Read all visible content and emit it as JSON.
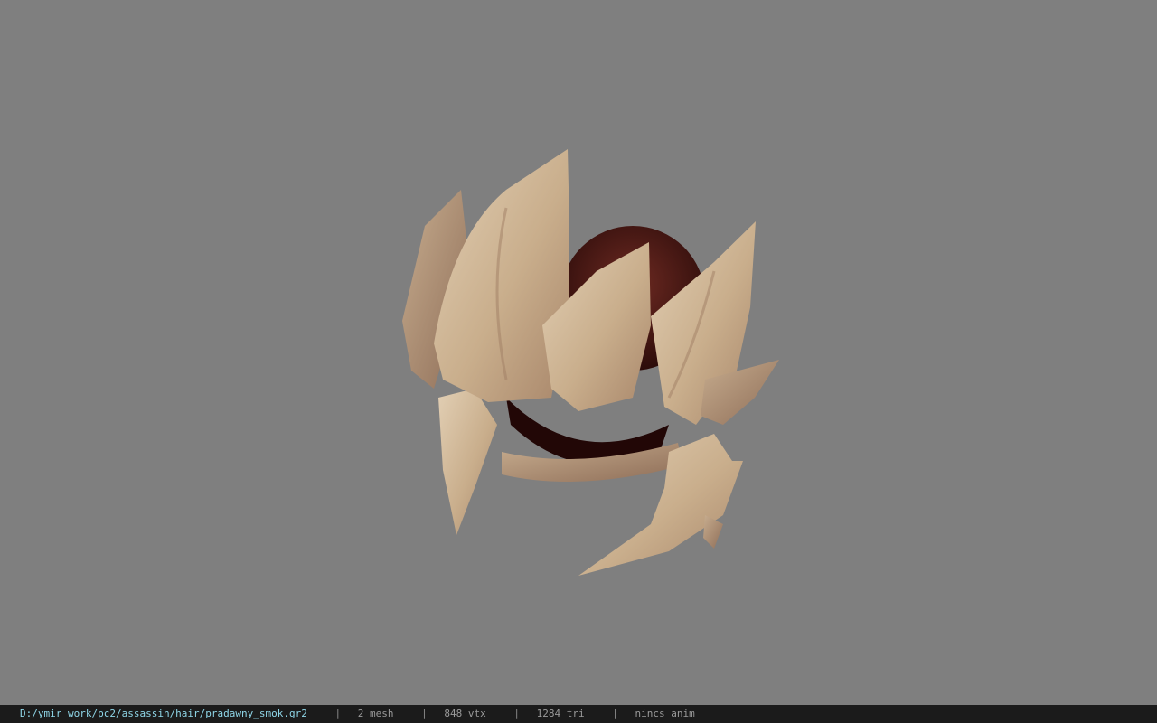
{
  "viewer": {
    "background_color": "#7f7f7f",
    "model_icon": "spiked-helmet-model"
  },
  "statusbar": {
    "file_path": "D:/ymir work/pc2/assassin/hair/pradawny_smok.gr2",
    "separator": "|",
    "mesh_count": "2 mesh",
    "vertex_count": "848 vtx",
    "triangle_count": "1284 tri",
    "animation": "nincs anim",
    "path_color": "#8fd6e8",
    "bar_color": "#1b1b1b"
  }
}
